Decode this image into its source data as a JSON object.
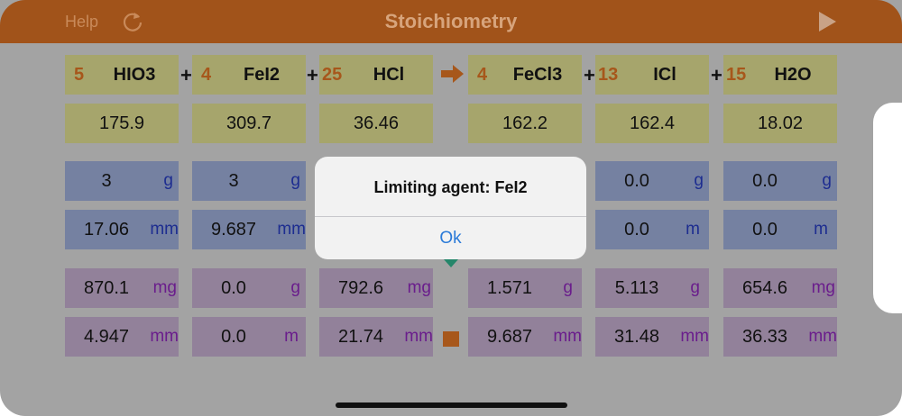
{
  "header": {
    "help_label": "Help",
    "title": "Stoichiometry",
    "refresh_icon": "refresh-icon",
    "play_icon": "play-icon"
  },
  "equation": {
    "operator_plus": "+",
    "arrow_icon": "right-arrow-icon",
    "species": [
      {
        "coef": "5",
        "formula": "HIO3",
        "molar_mass": "175.9",
        "mass_in": "3",
        "mass_in_unit": "g",
        "moles_in": "17.06",
        "moles_in_unit": "mm",
        "mass_out": "870.1",
        "mass_out_unit": "mg",
        "moles_out": "4.947",
        "moles_out_unit": "mm"
      },
      {
        "coef": "4",
        "formula": "FeI2",
        "molar_mass": "309.7",
        "mass_in": "3",
        "mass_in_unit": "g",
        "moles_in": "9.687",
        "moles_in_unit": "mm",
        "mass_out": "0.0",
        "mass_out_unit": "g",
        "moles_out": "0.0",
        "moles_out_unit": "m"
      },
      {
        "coef": "25",
        "formula": "HCl",
        "molar_mass": "36.46",
        "mass_in": "",
        "mass_in_unit": "",
        "moles_in": "",
        "moles_in_unit": "",
        "mass_out": "792.6",
        "mass_out_unit": "mg",
        "moles_out": "21.74",
        "moles_out_unit": "mm"
      },
      {
        "coef": "4",
        "formula": "FeCl3",
        "molar_mass": "162.2",
        "mass_in": "",
        "mass_in_unit": "",
        "moles_in": "",
        "moles_in_unit": "",
        "mass_out": "1.571",
        "mass_out_unit": "g",
        "moles_out": "9.687",
        "moles_out_unit": "mm"
      },
      {
        "coef": "13",
        "formula": "ICl",
        "molar_mass": "162.4",
        "mass_in": "0.0",
        "mass_in_unit": "g",
        "moles_in": "0.0",
        "moles_in_unit": "m",
        "mass_out": "5.113",
        "mass_out_unit": "g",
        "moles_out": "31.48",
        "moles_out_unit": "mm"
      },
      {
        "coef": "15",
        "formula": "H2O",
        "molar_mass": "18.02",
        "mass_in": "0.0",
        "mass_in_unit": "g",
        "moles_in": "0.0",
        "moles_in_unit": "m",
        "mass_out": "654.6",
        "mass_out_unit": "mg",
        "moles_out": "36.33",
        "moles_out_unit": "mm"
      }
    ]
  },
  "markers": {
    "input_marker_icon": "triangle-down-icon",
    "output_marker_icon": "square-icon"
  },
  "dialog": {
    "message": "Limiting agent: FeI2",
    "ok_label": "Ok"
  },
  "colors": {
    "header_brown": "#a1531a",
    "coefficient_orange": "#a7571b",
    "yellow_cell": "#a6a56c",
    "blue_cell": "#7581a1",
    "purple_cell": "#92819a",
    "link_blue": "#2a7ad8"
  }
}
